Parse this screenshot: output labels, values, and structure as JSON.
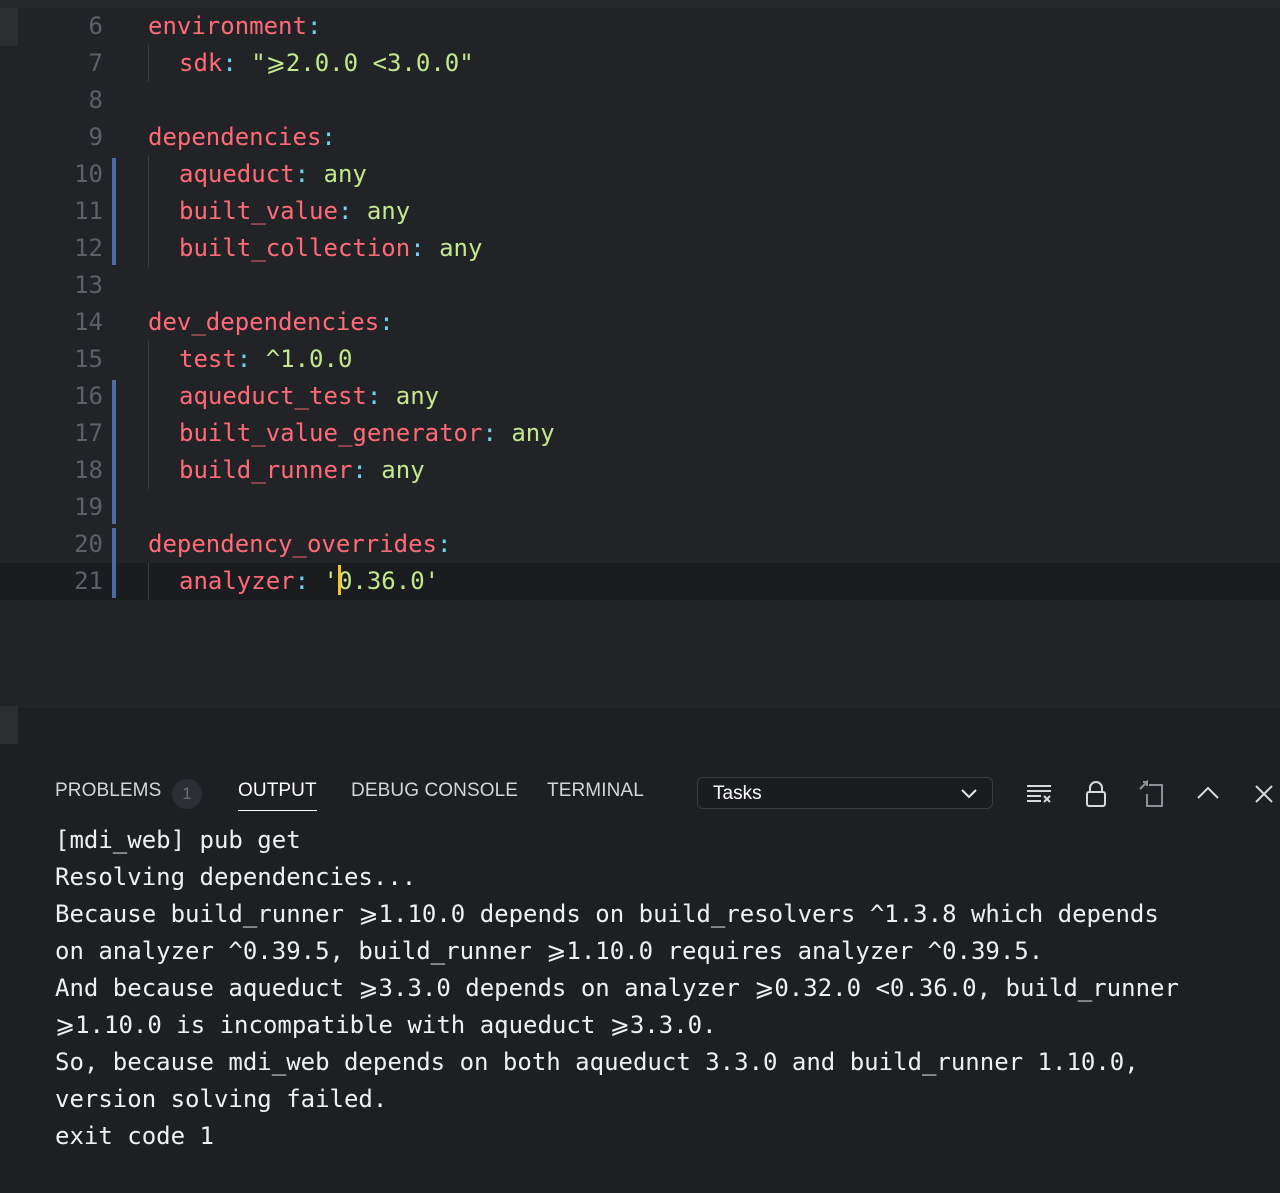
{
  "editor": {
    "lines": [
      {
        "n": "6",
        "indent": 0,
        "segments": [
          {
            "t": "environment",
            "c": "k"
          },
          {
            "t": ":",
            "c": "p"
          }
        ]
      },
      {
        "n": "7",
        "indent": 1,
        "segments": [
          {
            "t": "sdk",
            "c": "k"
          },
          {
            "t": ": ",
            "c": "p"
          },
          {
            "t": "\"⩾2.0.0 <3.0.0\"",
            "c": "v"
          }
        ]
      },
      {
        "n": "8",
        "indent": 0,
        "segments": []
      },
      {
        "n": "9",
        "indent": 0,
        "segments": [
          {
            "t": "dependencies",
            "c": "k"
          },
          {
            "t": ":",
            "c": "p"
          }
        ]
      },
      {
        "n": "10",
        "indent": 1,
        "segments": [
          {
            "t": "aqueduct",
            "c": "k"
          },
          {
            "t": ": ",
            "c": "p"
          },
          {
            "t": "any",
            "c": "v"
          }
        ]
      },
      {
        "n": "11",
        "indent": 1,
        "segments": [
          {
            "t": "built_value",
            "c": "k"
          },
          {
            "t": ": ",
            "c": "p"
          },
          {
            "t": "any",
            "c": "v"
          }
        ]
      },
      {
        "n": "12",
        "indent": 1,
        "segments": [
          {
            "t": "built_collection",
            "c": "k"
          },
          {
            "t": ": ",
            "c": "p"
          },
          {
            "t": "any",
            "c": "v"
          }
        ]
      },
      {
        "n": "13",
        "indent": 0,
        "segments": []
      },
      {
        "n": "14",
        "indent": 0,
        "segments": [
          {
            "t": "dev_dependencies",
            "c": "k"
          },
          {
            "t": ":",
            "c": "p"
          }
        ]
      },
      {
        "n": "15",
        "indent": 1,
        "segments": [
          {
            "t": "test",
            "c": "k"
          },
          {
            "t": ": ",
            "c": "p"
          },
          {
            "t": "^1.0.0",
            "c": "v"
          }
        ]
      },
      {
        "n": "16",
        "indent": 1,
        "segments": [
          {
            "t": "aqueduct_test",
            "c": "k"
          },
          {
            "t": ": ",
            "c": "p"
          },
          {
            "t": "any",
            "c": "v"
          }
        ]
      },
      {
        "n": "17",
        "indent": 1,
        "segments": [
          {
            "t": "built_value_generator",
            "c": "k"
          },
          {
            "t": ": ",
            "c": "p"
          },
          {
            "t": "any",
            "c": "v"
          }
        ]
      },
      {
        "n": "18",
        "indent": 1,
        "segments": [
          {
            "t": "build_runner",
            "c": "k"
          },
          {
            "t": ": ",
            "c": "p"
          },
          {
            "t": "any",
            "c": "v"
          }
        ]
      },
      {
        "n": "19",
        "indent": 0,
        "segments": []
      },
      {
        "n": "20",
        "indent": 0,
        "segments": [
          {
            "t": "dependency_overrides",
            "c": "k"
          },
          {
            "t": ":",
            "c": "p"
          }
        ]
      },
      {
        "n": "21",
        "indent": 1,
        "active": true,
        "segments": [
          {
            "t": "analyzer",
            "c": "k"
          },
          {
            "t": ": ",
            "c": "p"
          },
          {
            "t": "'",
            "c": "v"
          },
          {
            "cursor": true
          },
          {
            "t": "0.36.0'",
            "c": "v"
          }
        ]
      }
    ]
  },
  "panel": {
    "tabs": {
      "problems": "PROBLEMS",
      "problems_count": "1",
      "output": "OUTPUT",
      "debug_console": "DEBUG CONSOLE",
      "terminal": "TERMINAL"
    },
    "task_select": {
      "selected": "Tasks"
    },
    "icons": {
      "clear": "clear-output-icon",
      "lock": "lock-icon",
      "open": "open-in-editor-icon",
      "maximize": "chevron-up-icon",
      "close": "close-icon"
    },
    "output_lines": [
      "[mdi_web] pub get",
      "Resolving dependencies...",
      "Because build_runner ⩾1.10.0 depends on build_resolvers ^1.3.8 which depends",
      "on analyzer ^0.39.5, build_runner ⩾1.10.0 requires analyzer ^0.39.5.",
      "And because aqueduct ⩾3.3.0 depends on analyzer ⩾0.32.0 <0.36.0, build_runner",
      "⩾1.10.0 is incompatible with aqueduct ⩾3.3.0.",
      "So, because mdi_web depends on both aqueduct 3.3.0 and build_runner 1.10.0,",
      "version solving failed.",
      "exit code 1"
    ]
  },
  "colors": {
    "key": "#ff6a78",
    "punct": "#6fd3e9",
    "value": "#c3e88d",
    "cursor": "#f7c325",
    "gutter_modified": "#4e6aa6"
  }
}
